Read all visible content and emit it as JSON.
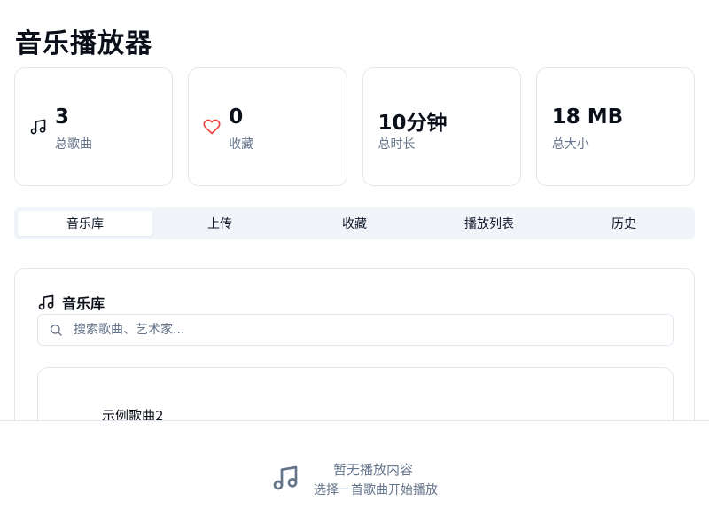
{
  "app": {
    "title": "音乐播放器"
  },
  "stats": [
    {
      "value": "3",
      "label": "总歌曲",
      "icon": "music-note-icon"
    },
    {
      "value": "0",
      "label": "收藏",
      "icon": "heart-icon"
    },
    {
      "value": "10分钟",
      "label": "总时长"
    },
    {
      "value": "18 MB",
      "label": "总大小"
    }
  ],
  "tabs": [
    {
      "label": "音乐库",
      "active": true
    },
    {
      "label": "上传"
    },
    {
      "label": "收藏"
    },
    {
      "label": "播放列表"
    },
    {
      "label": "历史"
    }
  ],
  "library": {
    "title": "音乐库",
    "search_placeholder": "搜索歌曲、艺术家...",
    "songs": [
      {
        "title": "示例歌曲2"
      }
    ]
  },
  "player": {
    "title": "暂无播放内容",
    "subtitle": "选择一首歌曲开始播放"
  },
  "colors": {
    "heart": "#ef4444",
    "muted": "#64748b",
    "border": "#e2e8f0",
    "tabs_bg": "#f1f5f9"
  }
}
